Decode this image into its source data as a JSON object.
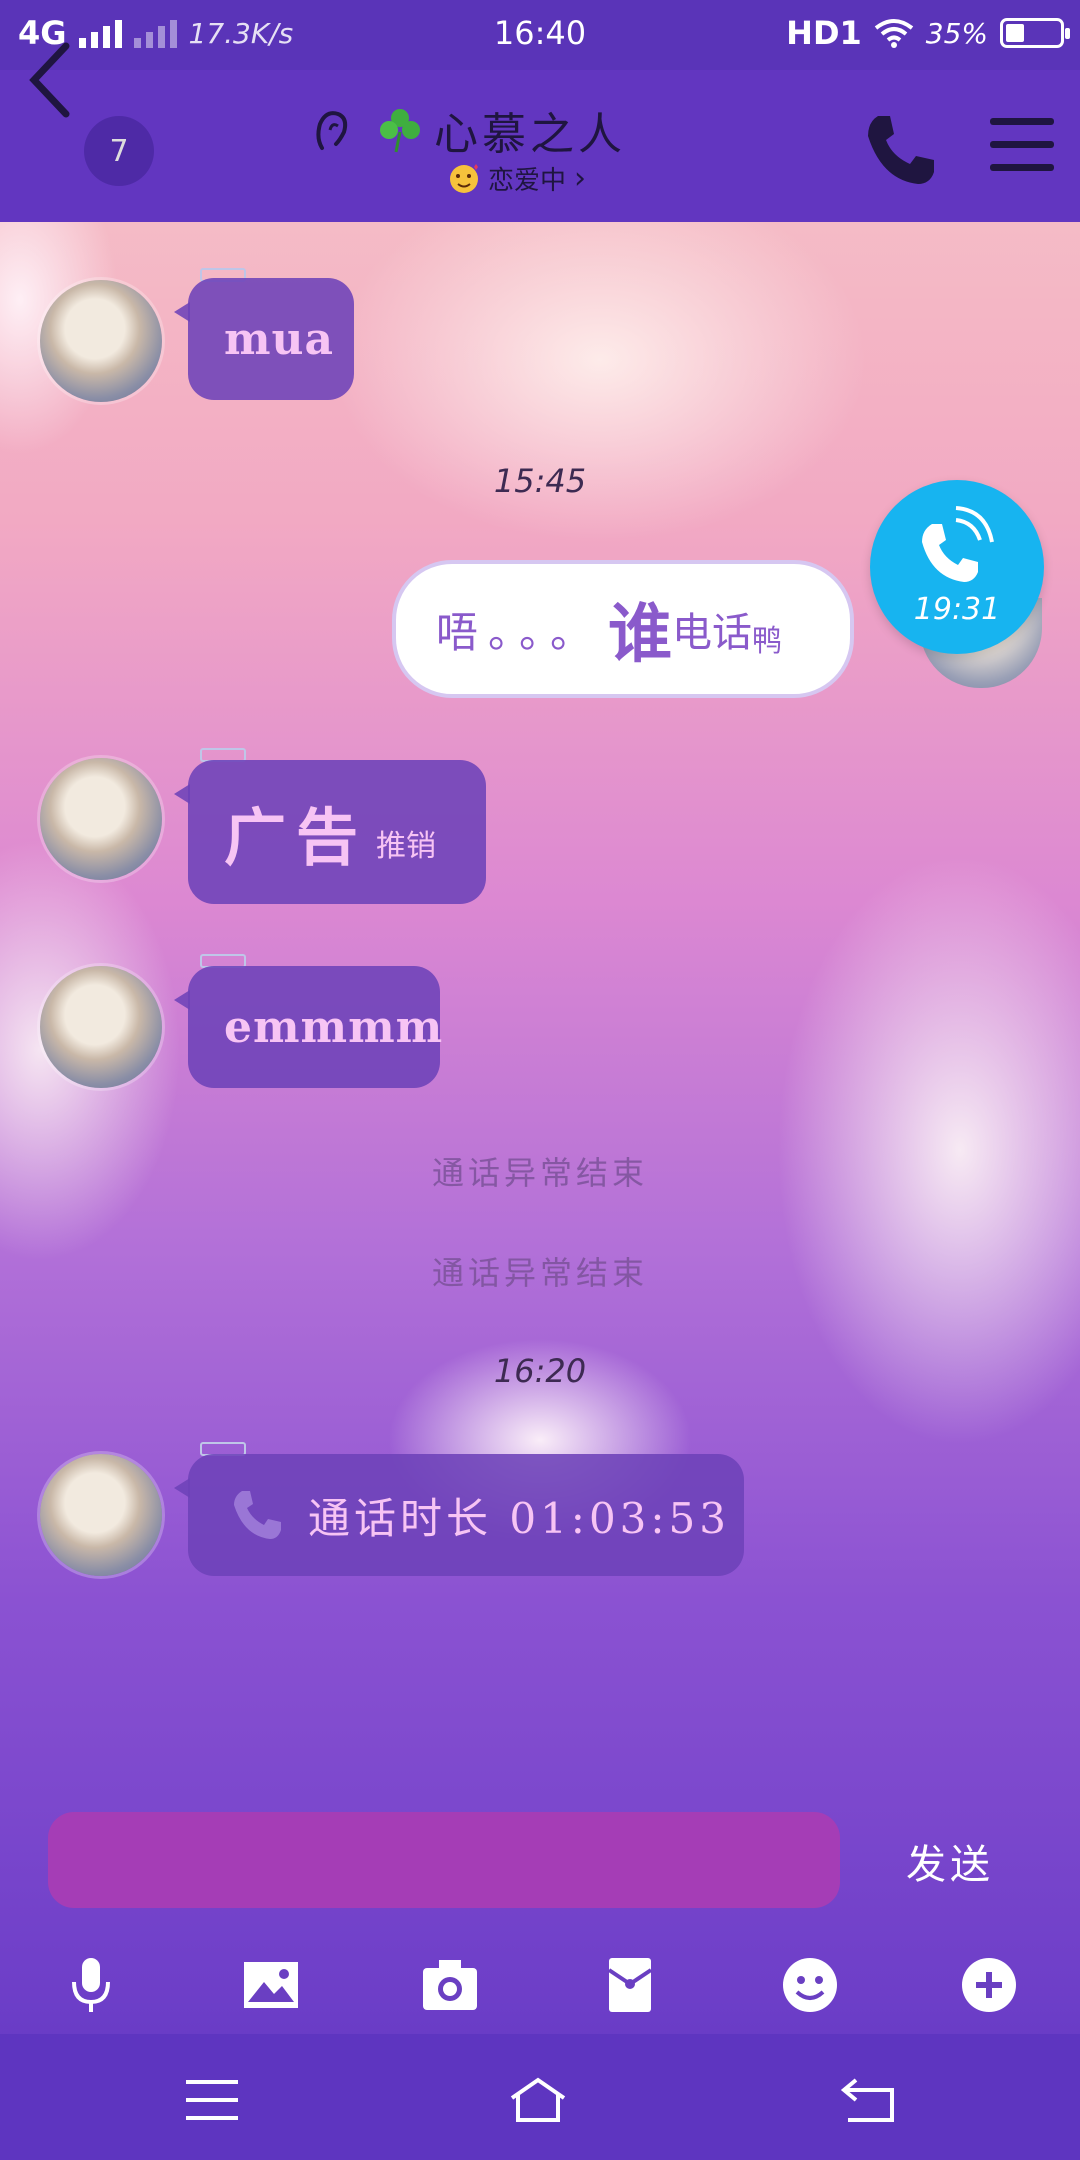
{
  "status_bar": {
    "network": "4G",
    "speed": "17.3K/s",
    "time": "16:40",
    "hd": "HD1",
    "battery": "35%",
    "battery_level": 0.35
  },
  "header": {
    "unread_count": "7",
    "title": "心慕之人",
    "subtitle": "恋爱中"
  },
  "messages": {
    "m1": "mua",
    "time1": "15:45",
    "sent_part1": "唔。。。",
    "sent_part2": "谁",
    "sent_part3": "电话",
    "sent_part4": "鸭",
    "call_fab_time": "19:31",
    "m2_big": "广告",
    "m2_small": "推销",
    "m3": "emmmm",
    "sys1": "通话异常结束",
    "sys2": "通话异常结束",
    "time2": "16:20",
    "call_label": "通话时长 01:03:53"
  },
  "input": {
    "send_label": "发送"
  },
  "colors": {
    "status_bar": "#5a34b8",
    "nav_bar": "#6236c0",
    "bubble": "#6d42b8",
    "bubble_text": "#f7c4f4",
    "fab": "#17b4f0",
    "input": "#a53db6"
  },
  "icons": [
    "back-chevron-icon",
    "ear-icon",
    "clover-icon",
    "love-face-icon",
    "phone-icon",
    "menu-icon",
    "mic-icon",
    "image-icon",
    "camera-icon",
    "red-packet-icon",
    "emoji-icon",
    "plus-icon",
    "nav-menu-icon",
    "nav-home-icon",
    "nav-back-icon"
  ]
}
